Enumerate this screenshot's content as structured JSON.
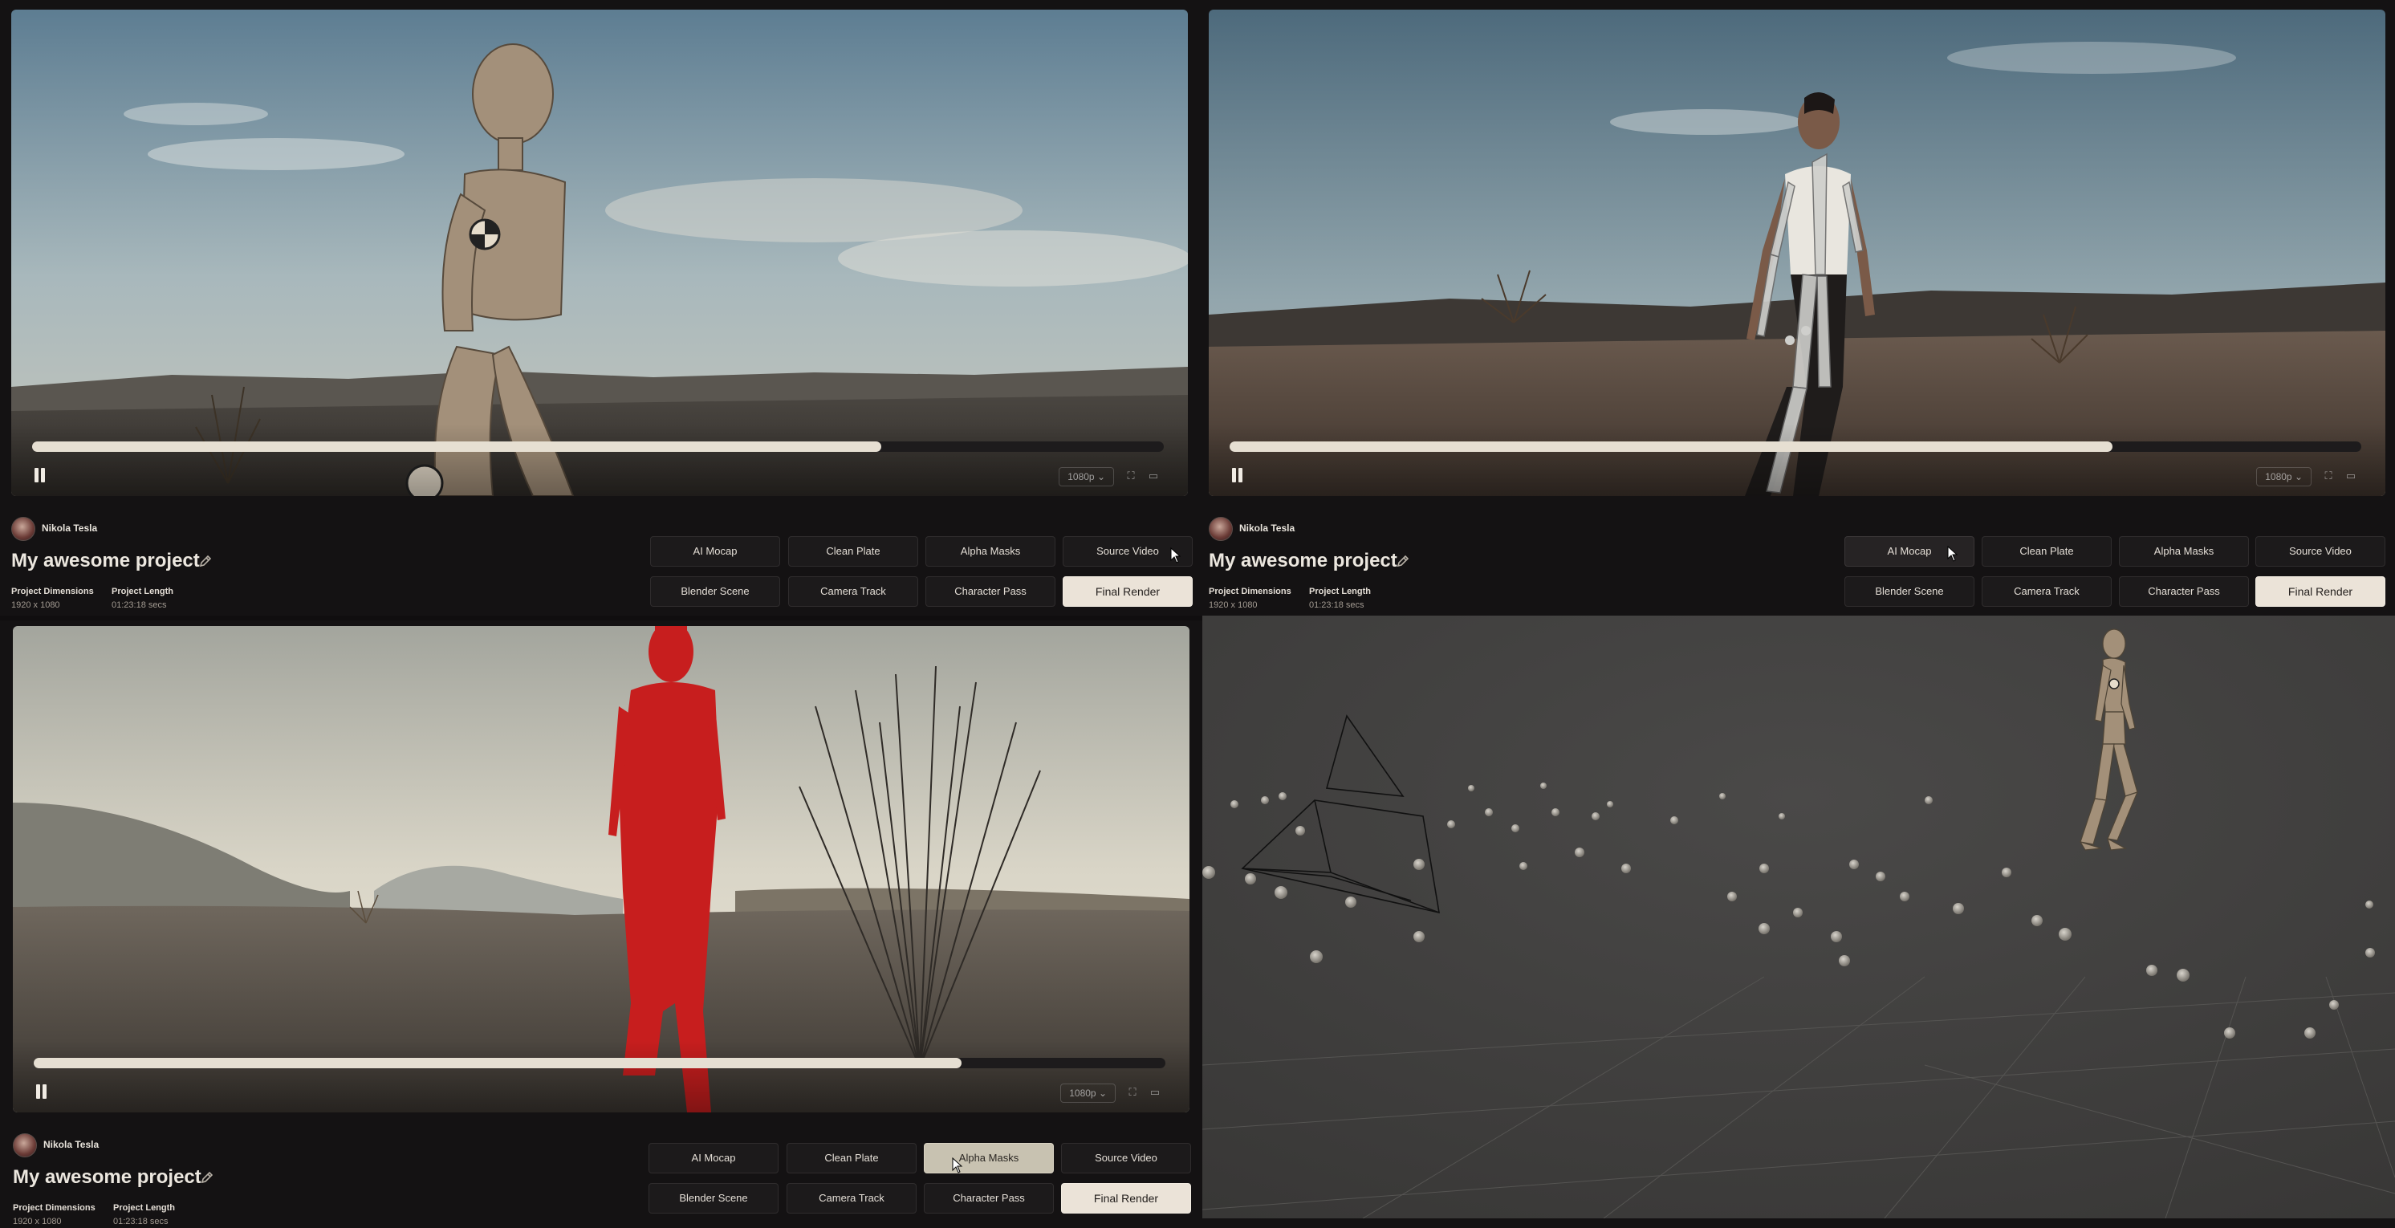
{
  "panels": [
    {
      "author": "Nikola Tesla",
      "project_title": "My awesome project",
      "dimensions_label": "Project Dimensions",
      "dimensions_value": "1920 x 1080",
      "length_label": "Project Length",
      "length_value": "01:23:18 secs",
      "quality": "1080p",
      "progress": 0.75,
      "active_tab": "Source Video",
      "buttons": [
        "AI Mocap",
        "Clean Plate",
        "Alpha Masks",
        "Source Video",
        "Blender Scene",
        "Camera Track",
        "Character Pass",
        "Final Render"
      ]
    },
    {
      "author": "Nikola Tesla",
      "project_title": "My awesome project",
      "dimensions_label": "Project Dimensions",
      "dimensions_value": "1920 x 1080",
      "length_label": "Project Length",
      "length_value": "01:23:18 secs",
      "quality": "1080p",
      "progress": 0.78,
      "active_tab": "AI Mocap",
      "buttons": [
        "AI Mocap",
        "Clean Plate",
        "Alpha Masks",
        "Source Video",
        "Blender Scene",
        "Camera Track",
        "Character Pass",
        "Final Render"
      ]
    },
    {
      "author": "Nikola Tesla",
      "project_title": "My awesome project",
      "dimensions_label": "Project Dimensions",
      "dimensions_value": "1920 x 1080",
      "length_label": "Project Length",
      "length_value": "01:23:18 secs",
      "quality": "1080p",
      "progress": 0.82,
      "active_tab": "Alpha Masks",
      "buttons": [
        "AI Mocap",
        "Clean Plate",
        "Alpha Masks",
        "Source Video",
        "Blender Scene",
        "Camera Track",
        "Character Pass",
        "Final Render"
      ]
    }
  ],
  "icons": {
    "pause": "pause-icon",
    "fullscreen": "fullscreen-icon",
    "closed_captions": "closed-captions-icon",
    "edit": "pencil-icon",
    "cursor": "mouse-pointer-icon"
  },
  "colors": {
    "background": "#141213",
    "progress_fill": "#e6dfd2",
    "final_render_button": "#ebe3d8",
    "active_button": "#c8c2b1",
    "alpha_mask": "#c71e1e",
    "viewport_bg": "#3f3e3d"
  }
}
